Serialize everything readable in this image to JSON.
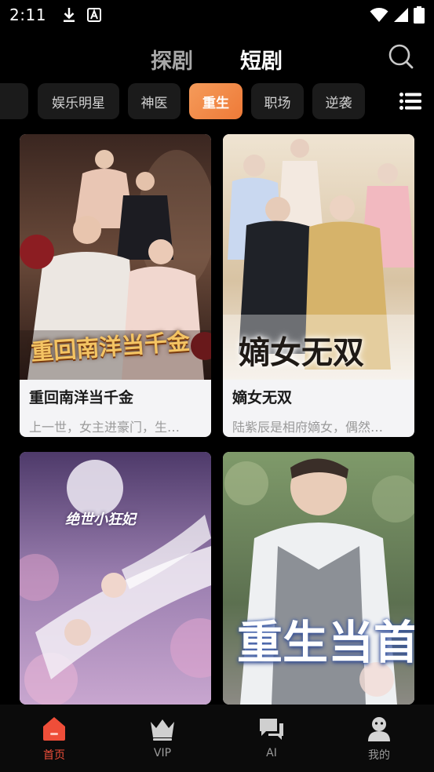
{
  "status_bar": {
    "time": "2:11"
  },
  "top_tabs": {
    "explore": "探剧",
    "short": "短剧"
  },
  "categories": [
    "娱乐明星",
    "神医",
    "重生",
    "职场",
    "逆袭"
  ],
  "active_category": "重生",
  "colors": {
    "accent": "#F08340",
    "nav_active": "#EF4E39",
    "card_bg": "#F4F4F6"
  },
  "dramas": [
    {
      "title": "重回南洋当千金",
      "desc": "上一世，女主进豪门，生…",
      "poster_text": "重回南洋当千金"
    },
    {
      "title": "嫡女无双",
      "desc": "陆紫辰是相府嫡女，偶然…",
      "poster_text": "嫡女无双"
    },
    {
      "title": "",
      "desc": "",
      "poster_text": "绝世小狂妃"
    },
    {
      "title": "",
      "desc": "",
      "poster_text": "重生当首富"
    }
  ],
  "bottom_nav": [
    {
      "label": "首页",
      "icon": "home-icon"
    },
    {
      "label": "VIP",
      "icon": "crown-icon"
    },
    {
      "label": "AI",
      "icon": "chat-icon"
    },
    {
      "label": "我的",
      "icon": "profile-icon"
    }
  ]
}
